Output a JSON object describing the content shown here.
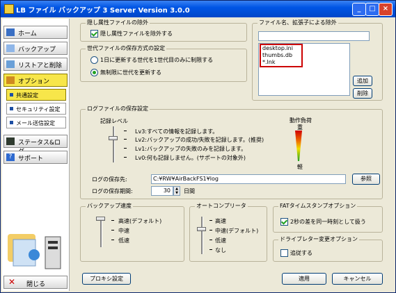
{
  "window": {
    "title": "LB ファイル バックアップ 3 Server Version 3.0.0"
  },
  "sidebar": {
    "items": [
      {
        "label": "ホーム"
      },
      {
        "label": "バックアップ"
      },
      {
        "label": "リストアと削除"
      },
      {
        "label": "オプション"
      }
    ],
    "sub_items": [
      {
        "label": "共通設定"
      },
      {
        "label": "セキュリティ設定"
      },
      {
        "label": "メール送信設定"
      }
    ],
    "more_items": [
      {
        "label": "ステータス&ログ"
      },
      {
        "label": "サポート"
      }
    ],
    "close_label": "閉じる"
  },
  "hidden_attr": {
    "title": "隠し属性ファイルの除外",
    "checkbox_label": "隠し属性ファイルを除外する",
    "checked": true
  },
  "generation": {
    "title": "世代ファイルの保存方式の設定",
    "options": [
      {
        "label": "1日に更新する世代を1世代目のみに制限する",
        "selected": false
      },
      {
        "label": "無制限に世代を更新する",
        "selected": true
      }
    ]
  },
  "exclusion": {
    "title": "ファイル名、拡張子による除外",
    "input_value": "",
    "entries": [
      "desktop.ini",
      "thumbs.db",
      "*.lnk"
    ],
    "add_label": "追加",
    "delete_label": "削除"
  },
  "log": {
    "title": "ログファイルの保存設定",
    "level_label": "記録レベル",
    "levels": [
      "Lv3:すべての情報を記録します。",
      "Lv2:バックアップの成功/失敗を記録します。(推奨)",
      "Lv1:バックアップの失敗のみを記録します。",
      "Lv0:何も記録しません。(サポートの対象外)"
    ],
    "selected_level": "Lv2",
    "load_label": "動作負荷",
    "load_heavy": "重",
    "load_light": "軽",
    "path_label": "ログの保存先:",
    "path_value": "C:¥RW¥AirBackFS1¥log",
    "browse_label": "参照",
    "period_label": "ログの保存期間:",
    "period_value": "30",
    "period_unit": "日間"
  },
  "backup_speed": {
    "title": "バックアップ速度",
    "options": [
      "高速(デフォルト)",
      "中速",
      "低速"
    ],
    "selected": "高速(デフォルト)"
  },
  "auto_compare": {
    "title": "オートコンプリータ",
    "options": [
      "高速",
      "中速(デフォルト)",
      "低速",
      "なし"
    ],
    "selected": "中速(デフォルト)"
  },
  "fat": {
    "title": "FATタイムスタンプオプション",
    "checkbox_label": "2秒の差を同一時刻として扱う",
    "checked": true
  },
  "drive_letter": {
    "title": "ドライブレター変更オプション",
    "checkbox_label": "追従する",
    "checked": false
  },
  "footer": {
    "proxy_label": "プロキシ設定",
    "apply_label": "適用",
    "cancel_label": "キャンセル"
  },
  "colors": {
    "accent": "#f7e64a",
    "title_bar": "#0055e5",
    "highlight": "#cc0000"
  }
}
